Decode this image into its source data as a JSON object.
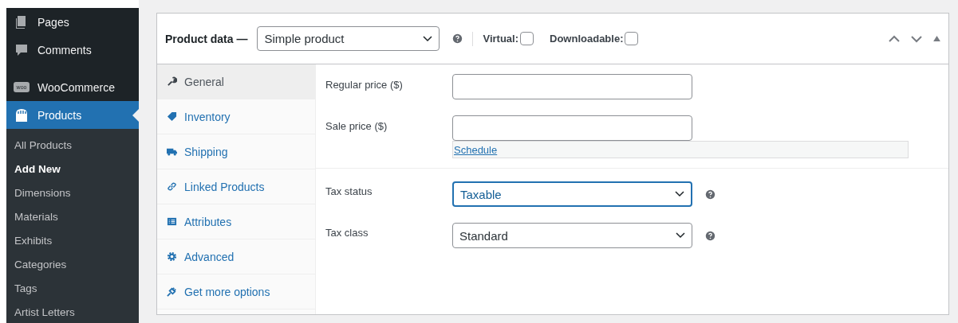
{
  "sidebar": {
    "items": [
      {
        "label": "Pages",
        "selected": false
      },
      {
        "label": "Comments",
        "selected": false
      },
      {
        "label": "WooCommerce",
        "selected": false
      },
      {
        "label": "Products",
        "selected": true
      }
    ],
    "woo_badge": "woo",
    "submenu": [
      {
        "label": "All Products",
        "selected": false
      },
      {
        "label": "Add New",
        "selected": true
      },
      {
        "label": "Dimensions",
        "selected": false
      },
      {
        "label": "Materials",
        "selected": false
      },
      {
        "label": "Exhibits",
        "selected": false
      },
      {
        "label": "Categories",
        "selected": false
      },
      {
        "label": "Tags",
        "selected": false
      },
      {
        "label": "Artist Letters",
        "selected": false
      }
    ]
  },
  "panel": {
    "title": "Product data —",
    "product_type": "Simple product",
    "options": [
      {
        "label": "Virtual:",
        "checked": false
      },
      {
        "label": "Downloadable:",
        "checked": false
      }
    ],
    "tabs": [
      {
        "label": "General",
        "selected": true
      },
      {
        "label": "Inventory",
        "selected": false
      },
      {
        "label": "Shipping",
        "selected": false
      },
      {
        "label": "Linked Products",
        "selected": false
      },
      {
        "label": "Attributes",
        "selected": false
      },
      {
        "label": "Advanced",
        "selected": false
      },
      {
        "label": "Get more options",
        "selected": false
      }
    ],
    "price_fields": [
      {
        "label": "Regular price ($)"
      },
      {
        "label": "Sale price ($)"
      }
    ],
    "schedule_link": "Schedule",
    "tax_fields": [
      {
        "label": "Tax status",
        "value": "Taxable",
        "focused": true
      },
      {
        "label": "Tax class",
        "value": "Standard",
        "focused": false
      }
    ]
  }
}
